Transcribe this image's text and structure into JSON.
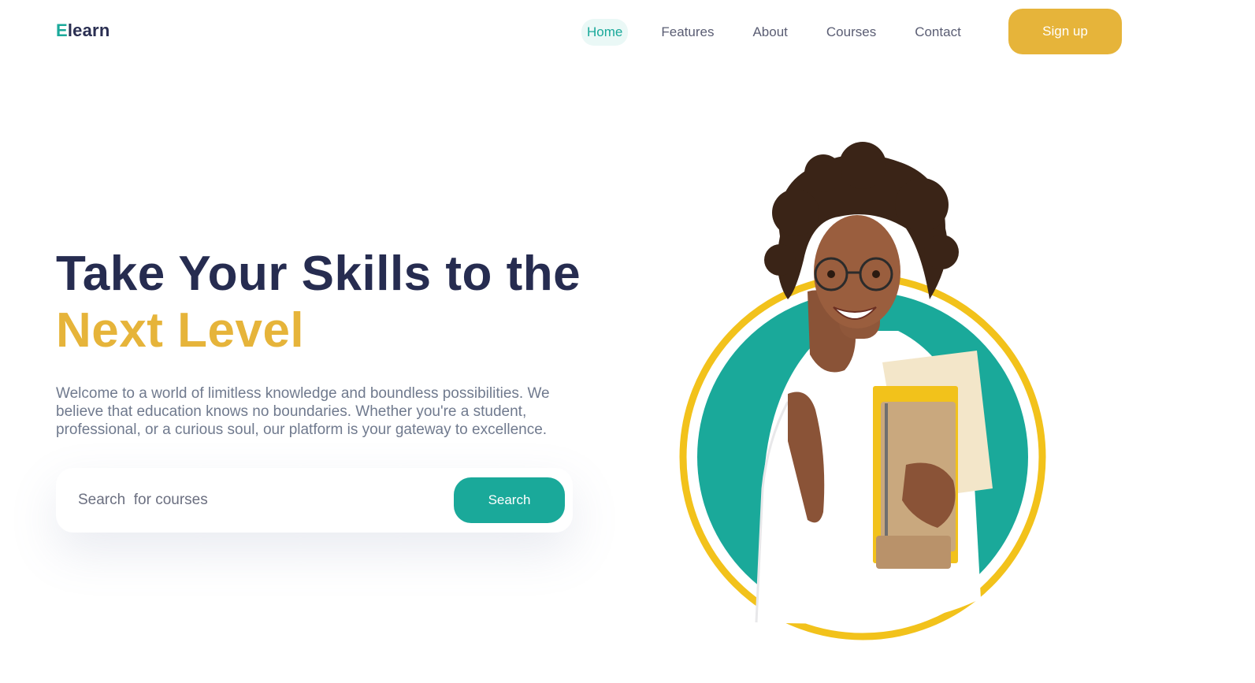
{
  "header": {
    "logo_initial": "E",
    "logo_rest": "learn",
    "nav": [
      {
        "label": "Home",
        "active": true
      },
      {
        "label": "Features",
        "active": false
      },
      {
        "label": "About",
        "active": false
      },
      {
        "label": "Courses",
        "active": false
      },
      {
        "label": "Contact",
        "active": false
      }
    ],
    "signup_label": "Sign up"
  },
  "hero": {
    "title_line1": "Take Your Skills to the",
    "title_line2": "Next Level",
    "description": "Welcome to a world of limitless knowledge and boundless possibilities. We believe that education knows no boundaries. Whether you're a student, professional, or a curious soul, our platform is your gateway to excellence.",
    "search": {
      "placeholder": "Search  for courses",
      "button_label": "Search"
    }
  },
  "colors": {
    "brand_teal": "#1aa99a",
    "accent_yellow": "#e6b43a",
    "title_navy": "#262c50",
    "ring_yellow": "#f2c21b"
  },
  "illustration": {
    "icon": "student-photo"
  }
}
